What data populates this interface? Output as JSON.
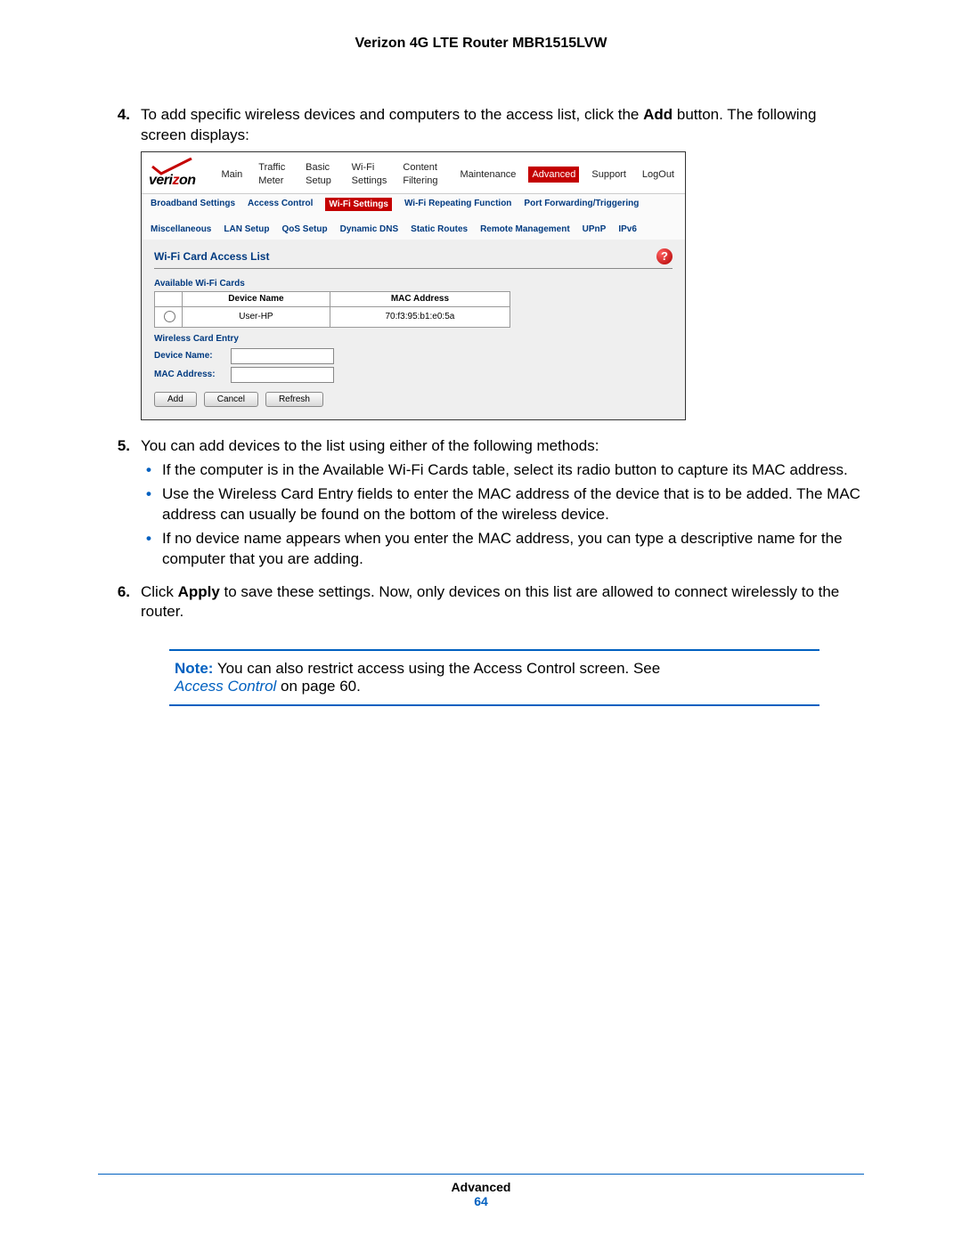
{
  "doc_title": "Verizon 4G LTE Router MBR1515LVW",
  "steps": {
    "s4": {
      "num": "4.",
      "text_a": "To add specific wireless devices and computers to the access list, click the ",
      "bold": "Add",
      "text_b": " button. The following screen displays:"
    },
    "s5": {
      "num": "5.",
      "text": "You can add devices to the list using either of the following methods:",
      "bullets": [
        "If the computer is in the Available Wi-Fi Cards table, select its radio button to capture its MAC address.",
        "Use the Wireless Card Entry fields to enter the MAC address of the device that is to be added. The MAC address can usually be found on the bottom of the wireless device.",
        "If no device name appears when you enter the MAC address, you can type a descriptive name for the computer that you are adding."
      ]
    },
    "s6": {
      "num": "6.",
      "text_a": "Click ",
      "bold": "Apply",
      "text_b": " to save these settings. Now, only devices on this list are allowed to connect wirelessly to the router."
    }
  },
  "note": {
    "label": "Note:",
    "text1": " You can also restrict access using the Access Control screen. See ",
    "link": "Access Control",
    "text2": " on page 60."
  },
  "footer": {
    "section": "Advanced",
    "page": "64"
  },
  "router": {
    "logo_text_a": "veri",
    "logo_text_b": "z",
    "logo_text_c": "on",
    "top_tabs": [
      "Main",
      "Traffic Meter",
      "Basic Setup",
      "Wi-Fi Settings",
      "Content Filtering",
      "Maintenance",
      "Advanced",
      "Support",
      "LogOut"
    ],
    "top_active": "Advanced",
    "sub_tabs_row1": [
      "Broadband Settings",
      "Access Control",
      "Wi-Fi Settings",
      "Wi-Fi Repeating Function",
      "Port Forwarding/Triggering",
      "Miscellaneous",
      "LAN Setup",
      "QoS Setup"
    ],
    "sub_tabs_row2": [
      "Dynamic DNS",
      "Static Routes",
      "Remote Management",
      "UPnP",
      "IPv6"
    ],
    "sub_active": "Wi-Fi Settings",
    "panel_title": "Wi-Fi Card Access List",
    "avail_label": "Available Wi-Fi Cards",
    "table": {
      "h1": "Device Name",
      "h2": "MAC Address",
      "row": {
        "name": "User-HP",
        "mac": "70:f3:95:b1:e0:5a"
      }
    },
    "entry_label": "Wireless Card Entry",
    "fields": {
      "device_name": "Device Name:",
      "mac": "MAC Address:"
    },
    "buttons": {
      "add": "Add",
      "cancel": "Cancel",
      "refresh": "Refresh"
    },
    "help": "?"
  }
}
